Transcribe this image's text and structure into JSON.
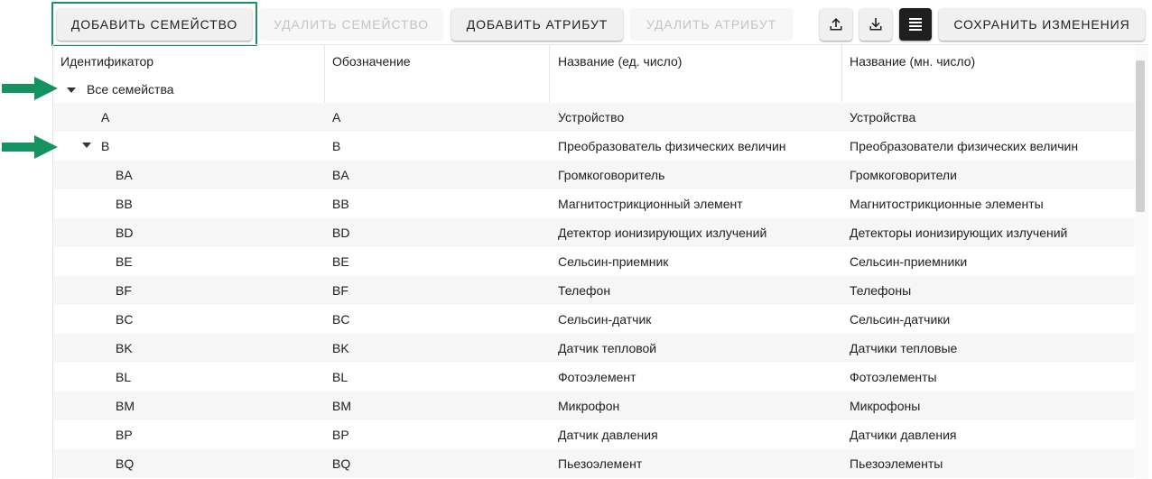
{
  "toolbar": {
    "add_family": "ДОБАВИТЬ СЕМЕЙСТВО",
    "delete_family": "УДАЛИТЬ СЕМЕЙСТВО",
    "add_attribute": "ДОБАВИТЬ АТРИБУТ",
    "delete_attribute": "УДАЛИТЬ АТРИБУТ",
    "upload_icon": "upload-icon",
    "download_icon": "download-icon",
    "list_icon": "list-icon",
    "save_changes": "СОХРАНИТЬ ИЗМЕНЕНИЯ"
  },
  "table": {
    "headers": [
      "Идентификатор",
      "Обозначение",
      "Название (ед. число)",
      "Название (мн. число)"
    ],
    "root": {
      "label": "Все семейства",
      "expanded": true
    },
    "rows": [
      {
        "id": "A",
        "code": "A",
        "singular": "Устройство",
        "plural": "Устройства"
      },
      {
        "id": "B",
        "code": "B",
        "singular": "Преобразователь физических величин",
        "plural": "Преобразователи физических величин",
        "expanded": true
      },
      {
        "id": "BA",
        "code": "BA",
        "singular": "Громкоговоритель",
        "plural": "Громкоговорители"
      },
      {
        "id": "BB",
        "code": "BB",
        "singular": "Магнитострикционный элемент",
        "plural": "Магнитострикционные элементы"
      },
      {
        "id": "BD",
        "code": "BD",
        "singular": "Детектор ионизирующих излучений",
        "plural": "Детекторы ионизирующих излучений"
      },
      {
        "id": "BE",
        "code": "BE",
        "singular": "Сельсин-приемник",
        "plural": "Сельсин-приемники"
      },
      {
        "id": "BF",
        "code": "BF",
        "singular": "Телефон",
        "plural": "Телефоны"
      },
      {
        "id": "BC",
        "code": "BC",
        "singular": "Сельсин-датчик",
        "plural": "Сельсин-датчики"
      },
      {
        "id": "BK",
        "code": "BK",
        "singular": "Датчик тепловой",
        "plural": "Датчики тепловые"
      },
      {
        "id": "BL",
        "code": "BL",
        "singular": "Фотоэлемент",
        "plural": "Фотоэлементы"
      },
      {
        "id": "BM",
        "code": "BM",
        "singular": "Микрофон",
        "plural": "Микрофоны"
      },
      {
        "id": "BP",
        "code": "BP",
        "singular": "Датчик давления",
        "plural": "Датчики давления"
      },
      {
        "id": "BQ",
        "code": "BQ",
        "singular": "Пьезоэлемент",
        "plural": "Пьезоэлементы"
      }
    ]
  },
  "colors": {
    "highlight": "#17925f",
    "arrow": "#15935e",
    "stripe": "#f6f6f6"
  }
}
